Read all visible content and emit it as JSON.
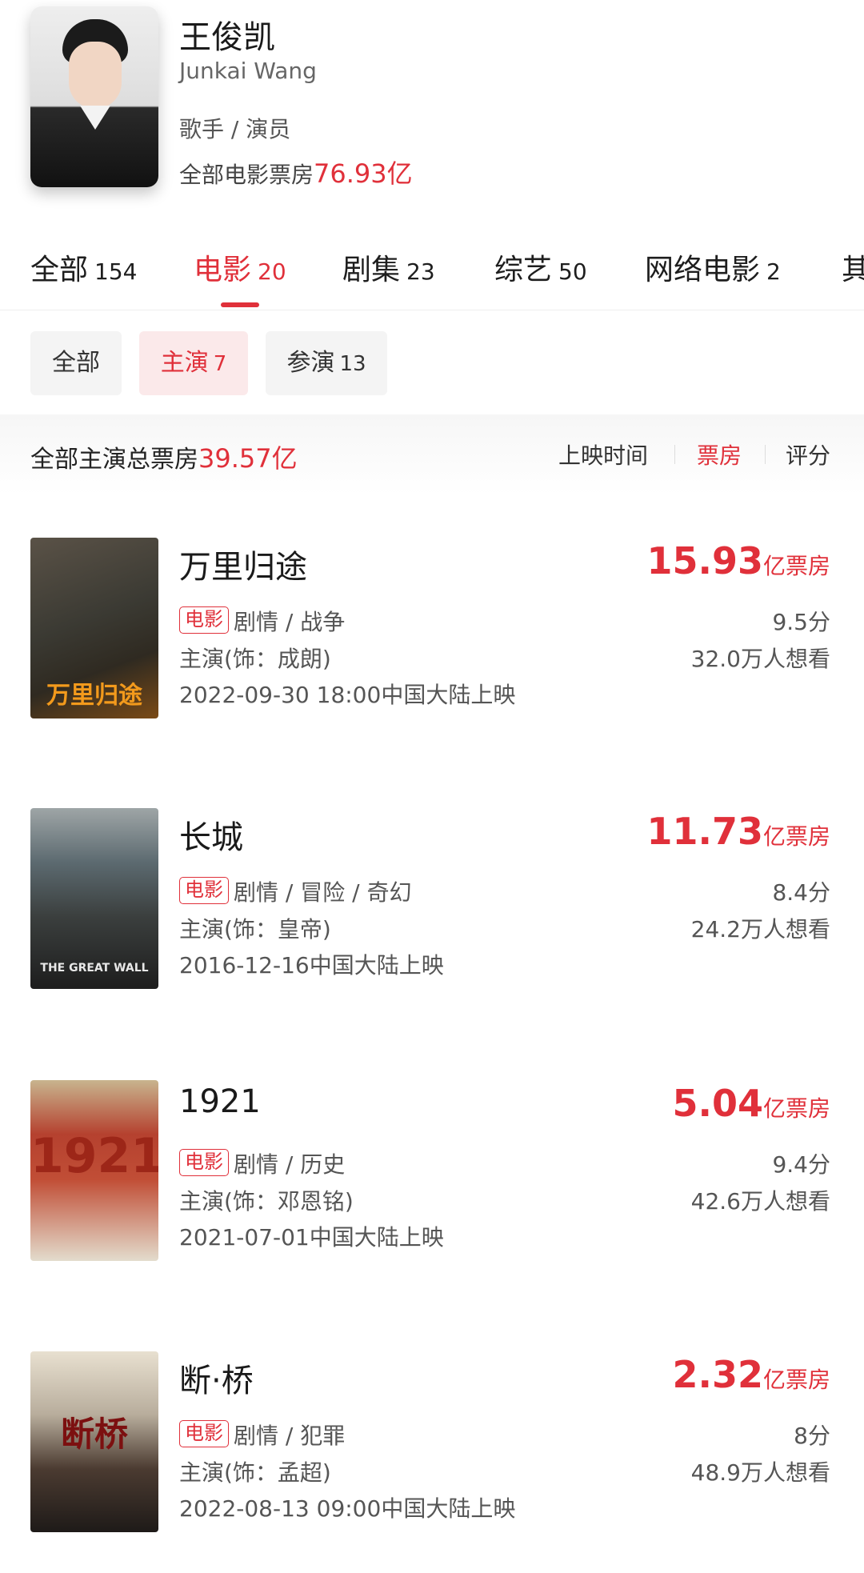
{
  "profile": {
    "name": "王俊凯",
    "name_en": "Junkai Wang",
    "role": "歌手 / 演员",
    "total_box_label": "全部电影票房",
    "total_box_value": "76.93亿"
  },
  "tabs": [
    {
      "label": "全部",
      "count": "154"
    },
    {
      "label": "电影",
      "count": "20"
    },
    {
      "label": "剧集",
      "count": "23"
    },
    {
      "label": "综艺",
      "count": "50"
    },
    {
      "label": "网络电影",
      "count": "2"
    },
    {
      "label": "其",
      "count": ""
    }
  ],
  "active_tab": "电影",
  "subtabs": [
    {
      "label": "全部",
      "count": ""
    },
    {
      "label": "主演",
      "count": "7"
    },
    {
      "label": "参演",
      "count": "13"
    }
  ],
  "summary": {
    "label": "全部主演总票房",
    "value": "39.57亿"
  },
  "sort_options": [
    "上映时间",
    "票房",
    "评分"
  ],
  "active_sort": "票房",
  "movies": [
    {
      "poster_text": "万里归途",
      "title": "万里归途",
      "tag": "电影",
      "genre": "剧情 / 战争",
      "role": "主演(饰：成朗)",
      "release": "2022-09-30 18:00中国大陆上映",
      "gross_value": "15.93",
      "gross_unit": "亿票房",
      "score": "9.5分",
      "want": "32.0万人想看"
    },
    {
      "poster_text": "THE GREAT WALL",
      "title": "长城",
      "tag": "电影",
      "genre": "剧情 / 冒险 / 奇幻",
      "role": "主演(饰：皇帝)",
      "release": "2016-12-16中国大陆上映",
      "gross_value": "11.73",
      "gross_unit": "亿票房",
      "score": "8.4分",
      "want": "24.2万人想看"
    },
    {
      "poster_text": "1921",
      "title": "1921",
      "tag": "电影",
      "genre": "剧情 / 历史",
      "role": "主演(饰：邓恩铭)",
      "release": "2021-07-01中国大陆上映",
      "gross_value": "5.04",
      "gross_unit": "亿票房",
      "score": "9.4分",
      "want": "42.6万人想看"
    },
    {
      "poster_text": "断桥",
      "title": "断·桥",
      "tag": "电影",
      "genre": "剧情 / 犯罪",
      "role": "主演(饰：孟超)",
      "release": "2022-08-13 09:00中国大陆上映",
      "gross_value": "2.32",
      "gross_unit": "亿票房",
      "score": "8分",
      "want": "48.9万人想看"
    }
  ],
  "colors": {
    "accent": "#e0303a",
    "accent_bg": "#fbe9ea",
    "chip_bg": "#f4f4f4",
    "text_primary": "#1a1a1a",
    "text_secondary": "#555555"
  }
}
